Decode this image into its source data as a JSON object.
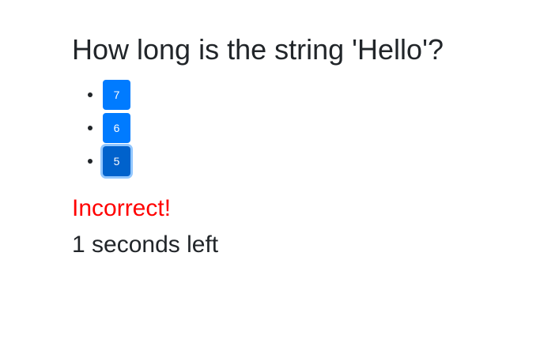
{
  "quiz": {
    "question": "How long is the string 'Hello'?",
    "answers": [
      {
        "label": "7"
      },
      {
        "label": "6"
      },
      {
        "label": "5"
      }
    ],
    "focused_answer_index": 2,
    "feedback": "Incorrect!",
    "timer": "1 seconds left"
  },
  "colors": {
    "button": "#007bff",
    "button_focused": "#0062cc",
    "feedback": "#ff0000",
    "text": "#212529"
  }
}
